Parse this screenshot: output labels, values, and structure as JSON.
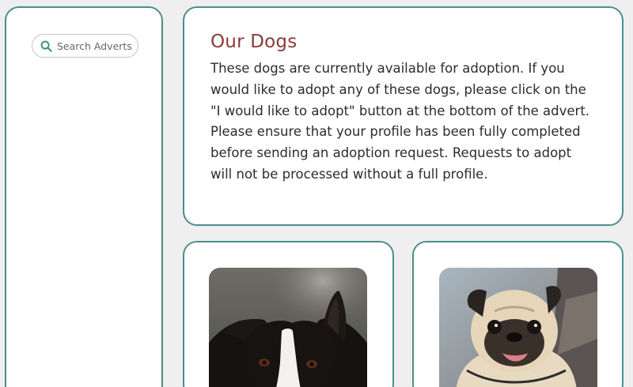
{
  "sidebar": {
    "search": {
      "placeholder": "Search Adverts",
      "icon": "search-icon"
    }
  },
  "intro": {
    "title": "Our Dogs",
    "body": "These dogs are currently available for adoption. If you would like to adopt any of these dogs, please click on the \"I would like to adopt\" button at the bottom of the advert. Please ensure that your profile has been fully completed before sending an adoption request. Requests to adopt will not be processed without a full profile."
  },
  "adverts": [
    {
      "photo": "border-collie-photo"
    },
    {
      "photo": "pug-photo"
    }
  ],
  "colors": {
    "accent": "#4a8f8c",
    "title": "#8a3a3a",
    "background": "#efefef"
  }
}
